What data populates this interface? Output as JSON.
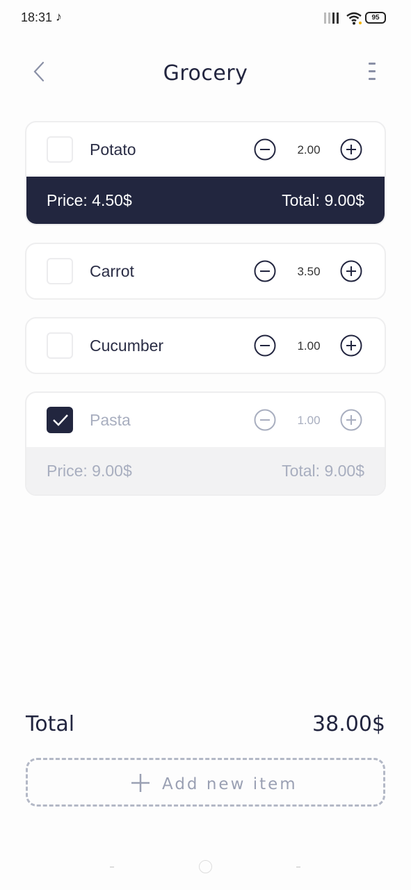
{
  "status_bar": {
    "time": "18:31",
    "battery": "95"
  },
  "header": {
    "title": "Grocery"
  },
  "items": [
    {
      "name": "Potato",
      "qty": "2.00",
      "price": "Price: 4.50$",
      "total": "Total: 9.00$"
    },
    {
      "name": "Carrot",
      "qty": "3.50"
    },
    {
      "name": "Cucumber",
      "qty": "1.00"
    },
    {
      "name": "Pasta",
      "qty": "1.00",
      "price": "Price: 9.00$",
      "total": "Total: 9.00$"
    }
  ],
  "footer": {
    "total_label": "Total",
    "total_value": "38.00$",
    "add_label": "Add new item"
  },
  "colors": {
    "accent": "#22263f",
    "muted": "#a8aebf",
    "card_border": "#eeeeef"
  }
}
